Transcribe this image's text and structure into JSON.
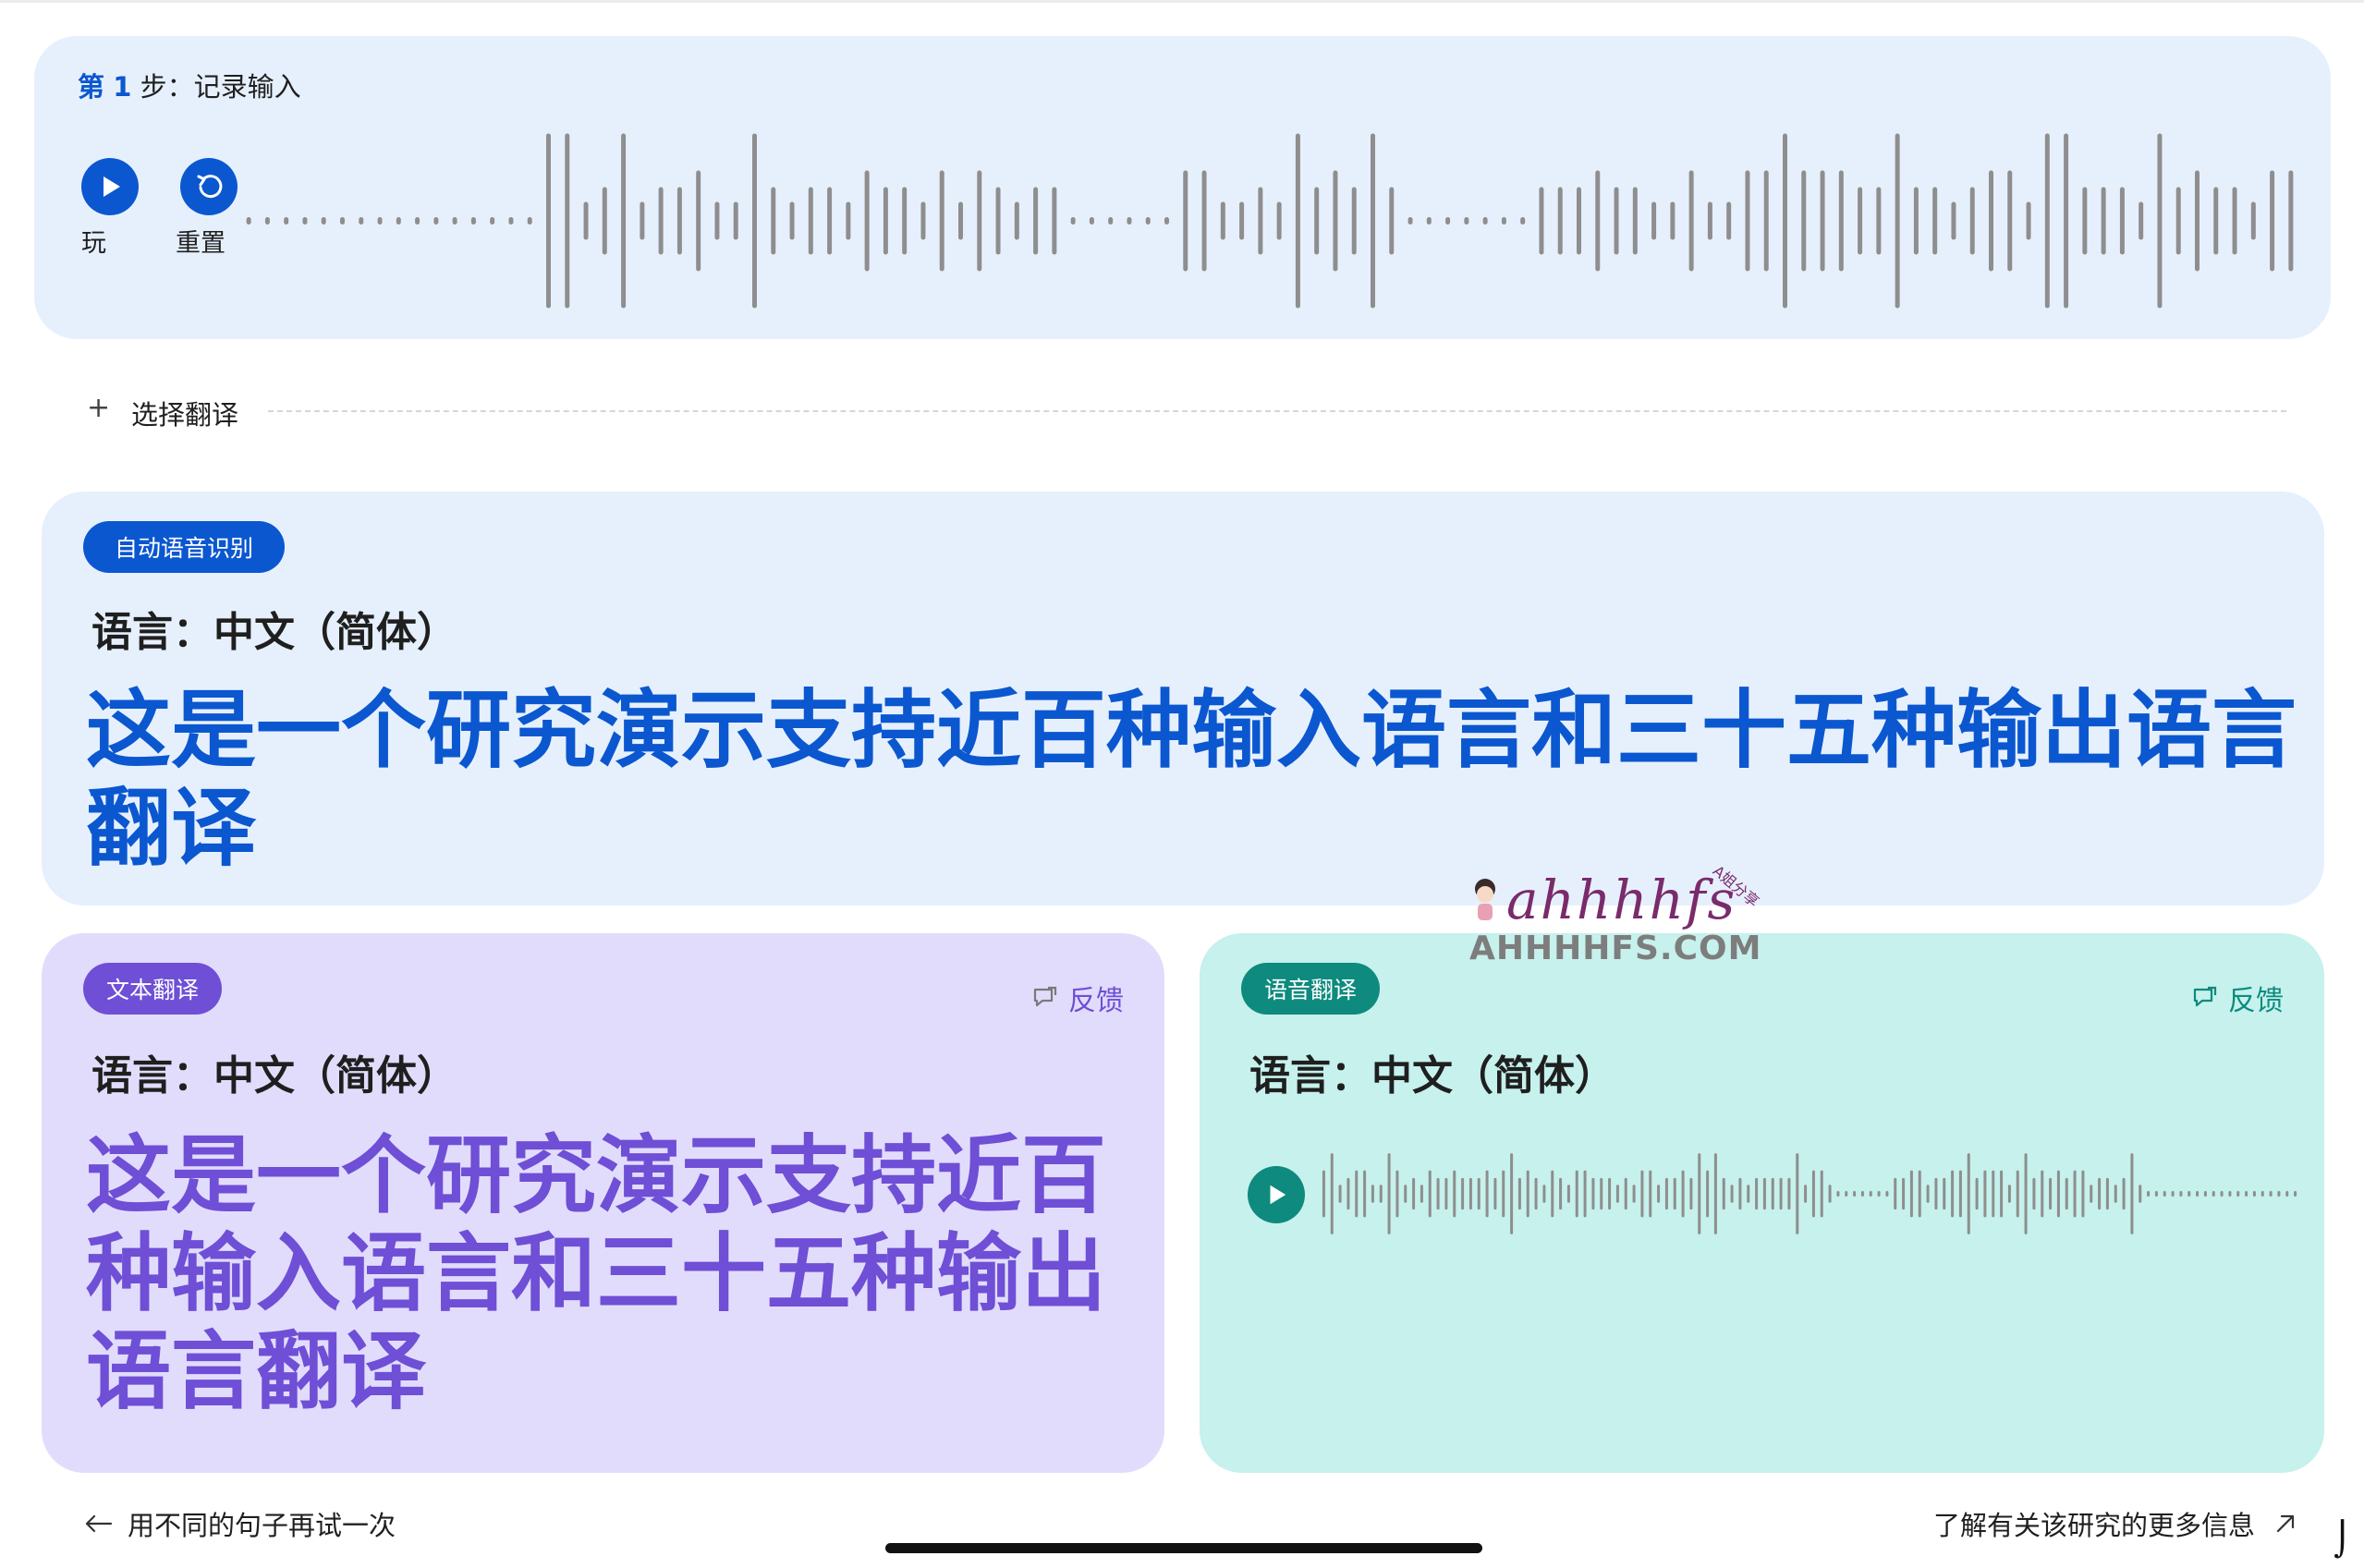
{
  "step1": {
    "title_prefix": "第",
    "title_number": "1",
    "title_suffix": "步：记录输入",
    "play_label": "玩",
    "reset_label": "重置"
  },
  "select_translation": {
    "plus": "+",
    "label": "选择翻译"
  },
  "asr_card": {
    "badge": "自动语音识别",
    "language": "语言：中文（简体）",
    "text": "这是一个研究演示支持近百种输入语言和三十五种输出语言翻译",
    "accent": "#0b57d0"
  },
  "text_translation_card": {
    "badge": "文本翻译",
    "feedback": "反馈",
    "language": "语言：中文（简体）",
    "text": "这是一个研究演示支持近百种输入语言和三十五种输出语言翻译",
    "accent": "#6e4fd6"
  },
  "speech_translation_card": {
    "badge": "语音翻译",
    "feedback": "反馈",
    "language": "语言：中文（简体）",
    "accent": "#0e8a7e"
  },
  "footer": {
    "left_link": "用不同的句子再试一次",
    "right_link": "了解有关该研究的更多信息"
  },
  "watermark": {
    "script": "ahhhhfs",
    "site": "AHHHHFS.COM",
    "badge": "A姐分享"
  }
}
